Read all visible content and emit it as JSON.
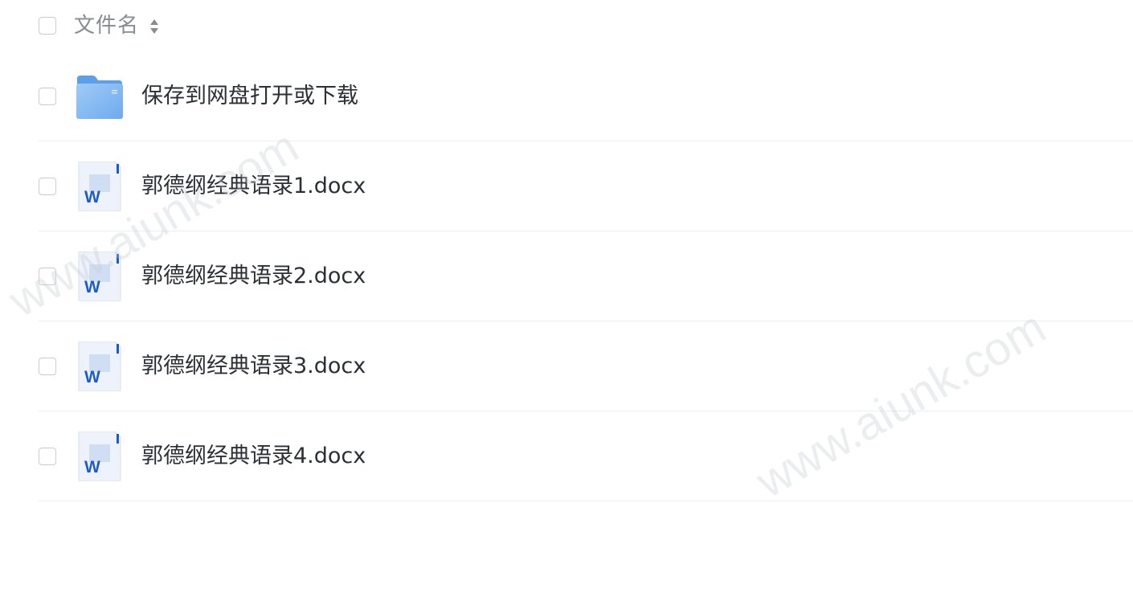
{
  "header": {
    "column_label": "文件名"
  },
  "files": [
    {
      "name": "保存到网盘打开或下载",
      "type": "folder"
    },
    {
      "name": "郭德纲经典语录1.docx",
      "type": "word",
      "icon_letter": "W"
    },
    {
      "name": "郭德纲经典语录2.docx",
      "type": "word",
      "icon_letter": "W"
    },
    {
      "name": "郭德纲经典语录3.docx",
      "type": "word",
      "icon_letter": "W"
    },
    {
      "name": "郭德纲经典语录4.docx",
      "type": "word",
      "icon_letter": "W"
    }
  ],
  "watermarks": [
    "www.aiunk.com",
    "www.aiunk.com"
  ],
  "colors": {
    "folder": "#7fb6f2",
    "word_blue": "#1d5cc7",
    "divider": "#eceef1",
    "header_text": "#878b92"
  }
}
